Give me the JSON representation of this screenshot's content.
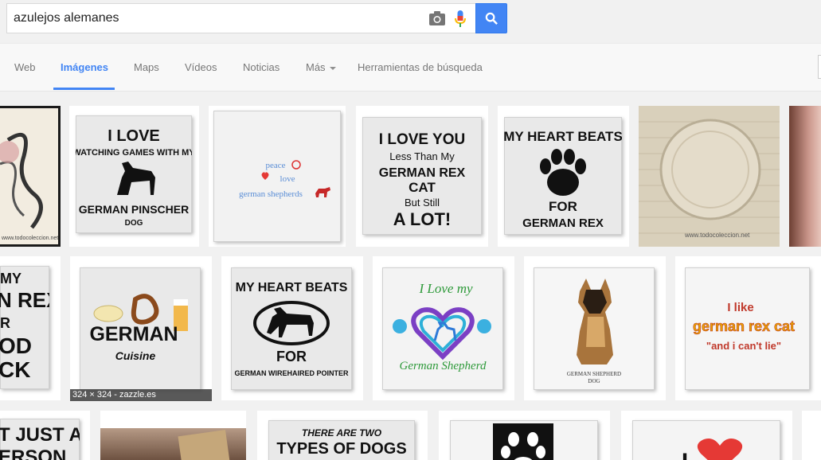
{
  "search": {
    "query": "azulejos alemanes"
  },
  "nav": {
    "tabs": [
      {
        "label": "Web"
      },
      {
        "label": "Imágenes"
      },
      {
        "label": "Maps"
      },
      {
        "label": "Vídeos"
      },
      {
        "label": "Noticias"
      },
      {
        "label": "Más"
      },
      {
        "label": "Herramientas de búsqueda"
      }
    ]
  },
  "icons": {
    "camera": "camera-icon",
    "mic": "microphone-icon",
    "search": "search-icon"
  },
  "colors": {
    "accent": "#4285f4",
    "mic_red": "#ea4335",
    "heart": "#e53935"
  },
  "results": {
    "row1": [
      {
        "lines": [
          "www.todocoleccion.net"
        ]
      },
      {
        "lines": [
          "I LOVE",
          "WATCHING GAMES WITH MY",
          "GERMAN PINSCHER",
          "DOG"
        ]
      },
      {
        "lines": [
          "peace",
          "love",
          "german shepherds"
        ]
      },
      {
        "lines": [
          "I LOVE YOU",
          "Less Than My",
          "GERMAN REX",
          "CAT",
          "But Still",
          "A LOT!"
        ]
      },
      {
        "lines": [
          "MY HEART BEATS",
          "FOR",
          "GERMAN REX"
        ]
      },
      {
        "lines": [
          "www.todocoleccion.net"
        ]
      }
    ],
    "row2": [
      {
        "lines": [
          "MY",
          "N REX",
          "R",
          "OD",
          "CK"
        ]
      },
      {
        "lines": [
          "GERMAN",
          "Cuisine"
        ],
        "caption": "324 × 324 - zazzle.es"
      },
      {
        "lines": [
          "MY HEART BEATS",
          "FOR",
          "GERMAN WIREHAIRED POINTER"
        ]
      },
      {
        "lines": [
          "I Love my",
          "German Shepherd"
        ]
      },
      {
        "lines": [
          "GERMAN SHEPHERD",
          "DOG"
        ]
      },
      {
        "lines": [
          "I like",
          "german rex cat",
          "\"and i can't lie\""
        ]
      }
    ],
    "row3": [
      {
        "lines": [
          "T JUST A",
          "ERSON"
        ]
      },
      {
        "lines": []
      },
      {
        "lines": [
          "THERE ARE TWO",
          "TYPES OF DOGS"
        ]
      },
      {
        "lines": []
      },
      {
        "lines": [
          "I"
        ]
      }
    ]
  }
}
